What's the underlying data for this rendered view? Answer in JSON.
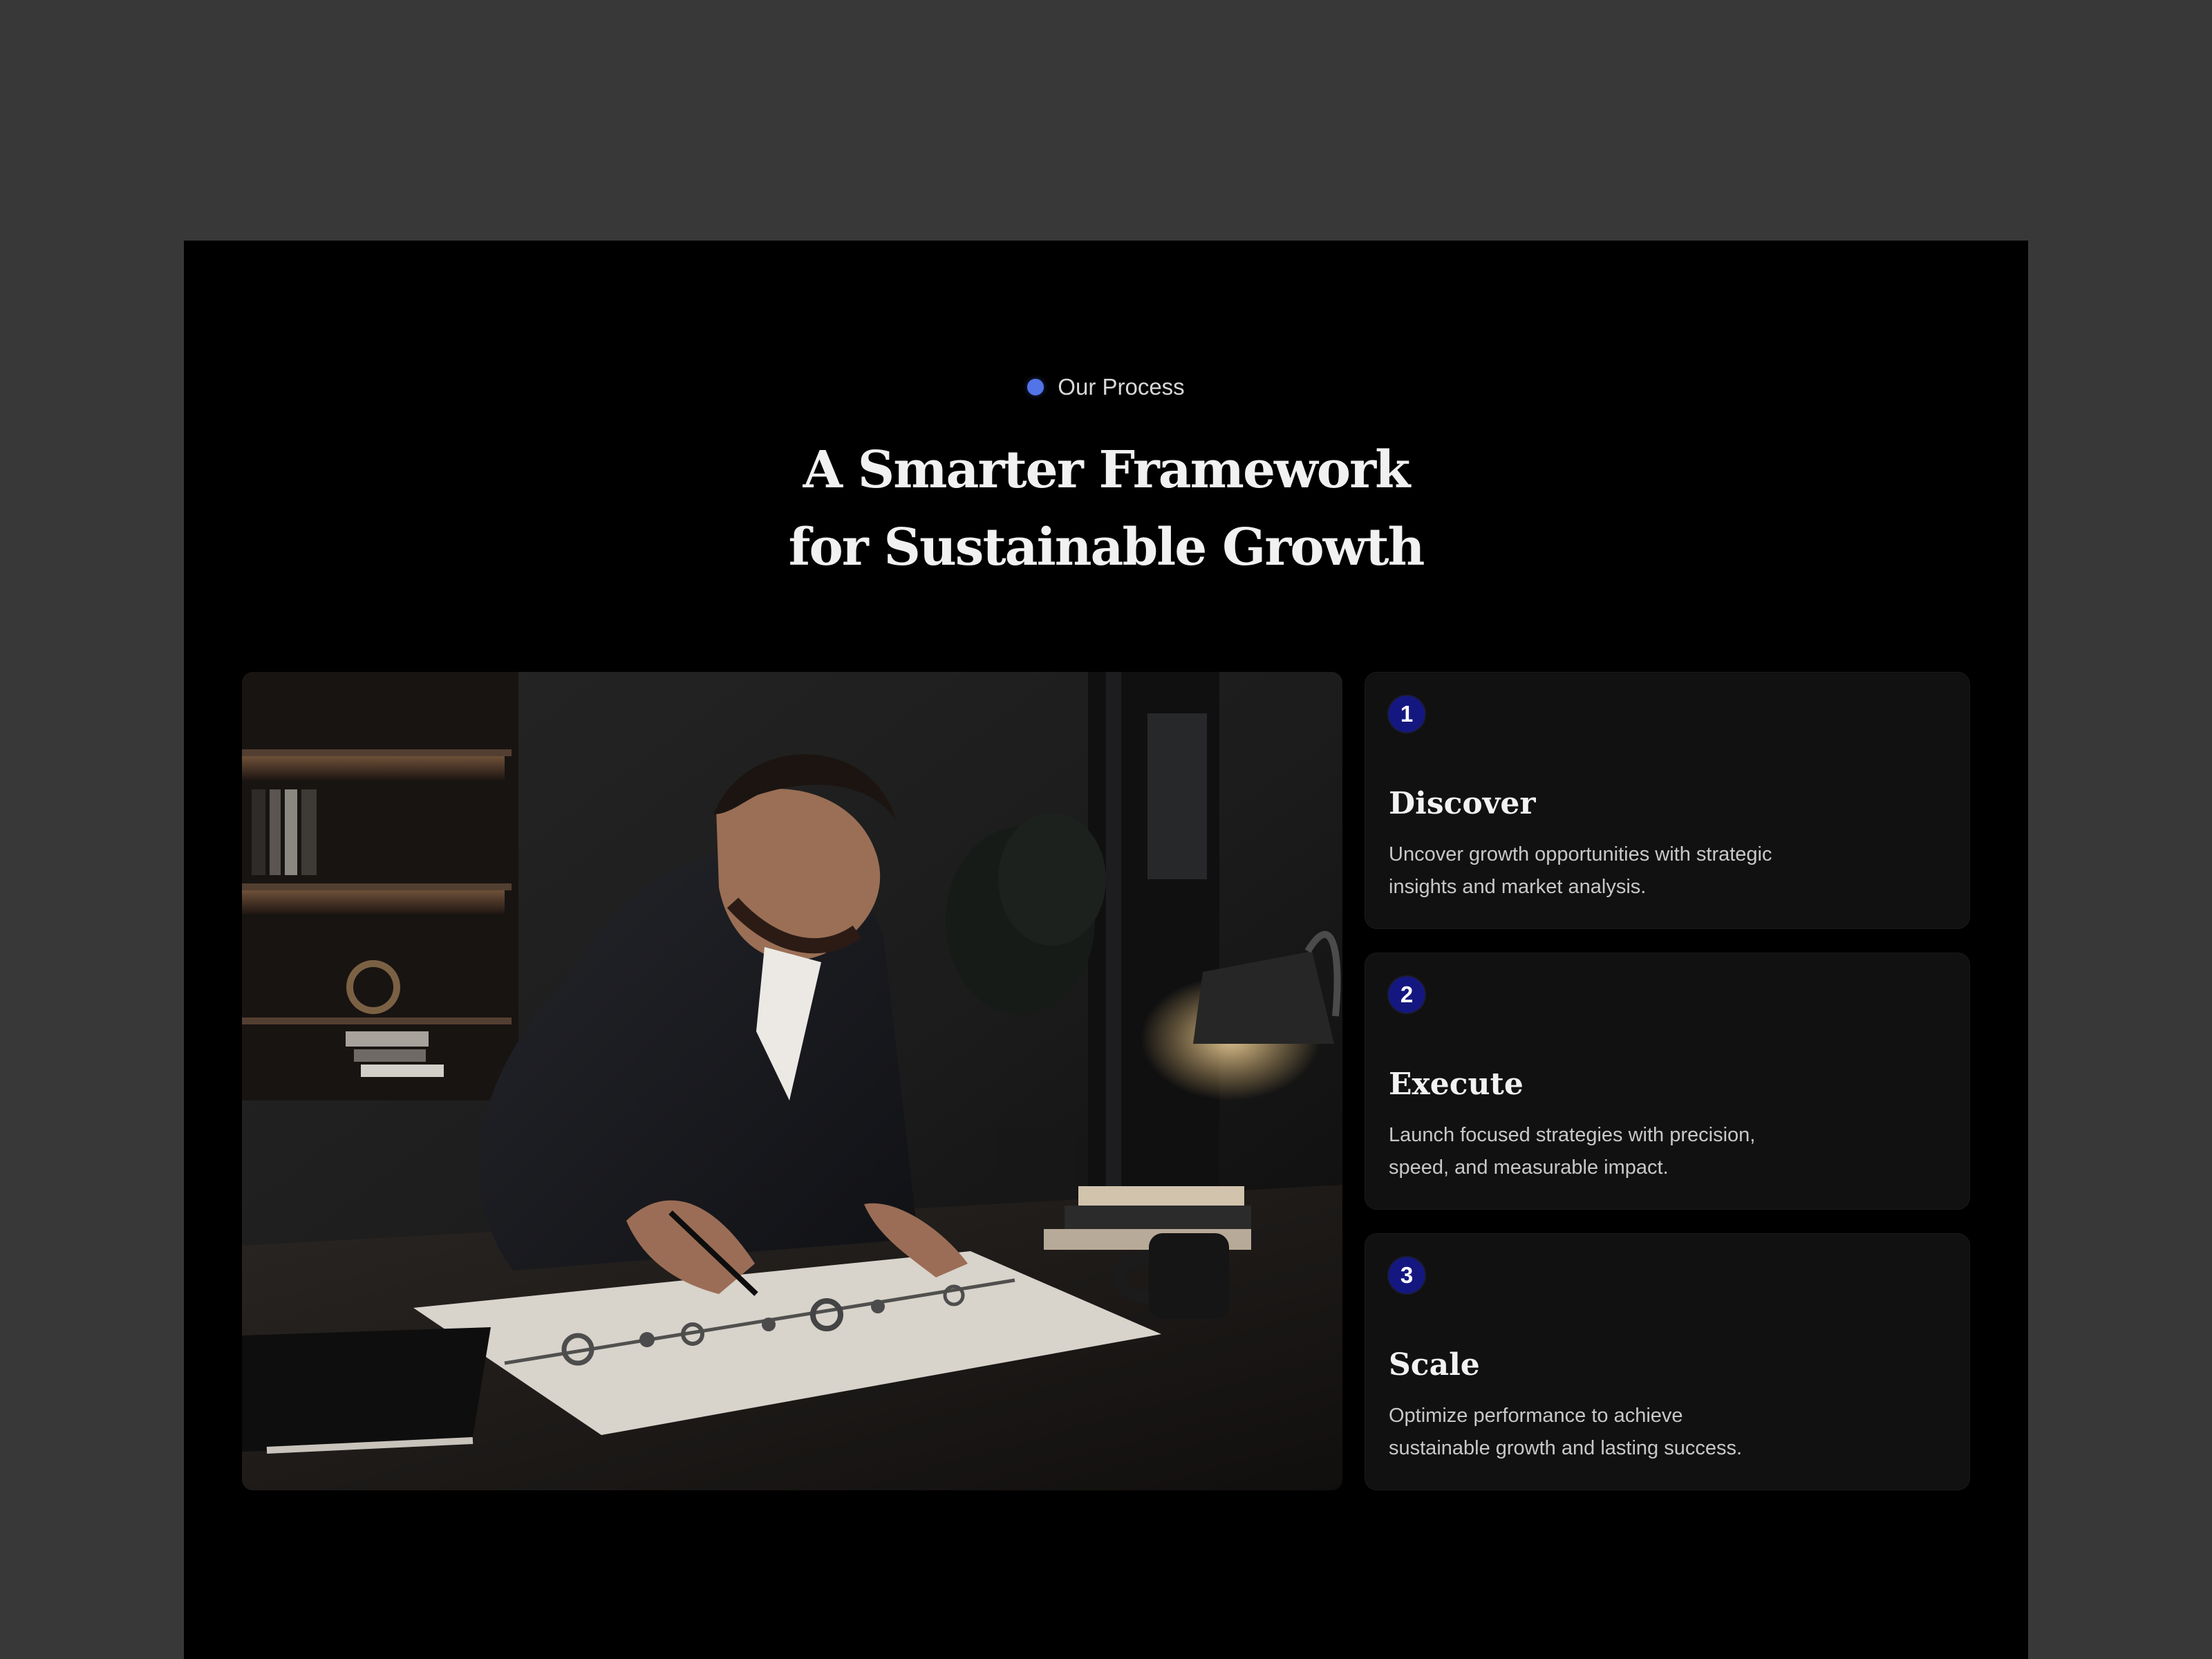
{
  "section": {
    "eyebrow": "Our Process",
    "headline_lines": [
      "A Smarter Framework",
      "for Sustainable Growth"
    ]
  },
  "media": {
    "image_subject": "businessman drawing a process roadmap on a desk",
    "image_name": "process-planning-photo"
  },
  "steps": [
    {
      "number": "1",
      "title": "Discover",
      "description": "Uncover growth opportunities with strategic insights and market analysis."
    },
    {
      "number": "2",
      "title": "Execute",
      "description": "Launch focused strategies with precision, speed, and measurable impact."
    },
    {
      "number": "3",
      "title": "Scale",
      "description": "Optimize performance to achieve sustainable growth and lasting success."
    }
  ],
  "colors": {
    "outer_background": "#383838",
    "section_background": "#000000",
    "card_background": "#111111",
    "accent_dot": "#5274e8",
    "number_badge": "#151781",
    "heading_text": "#f1f1f1",
    "body_text": "#c8c8c8"
  }
}
